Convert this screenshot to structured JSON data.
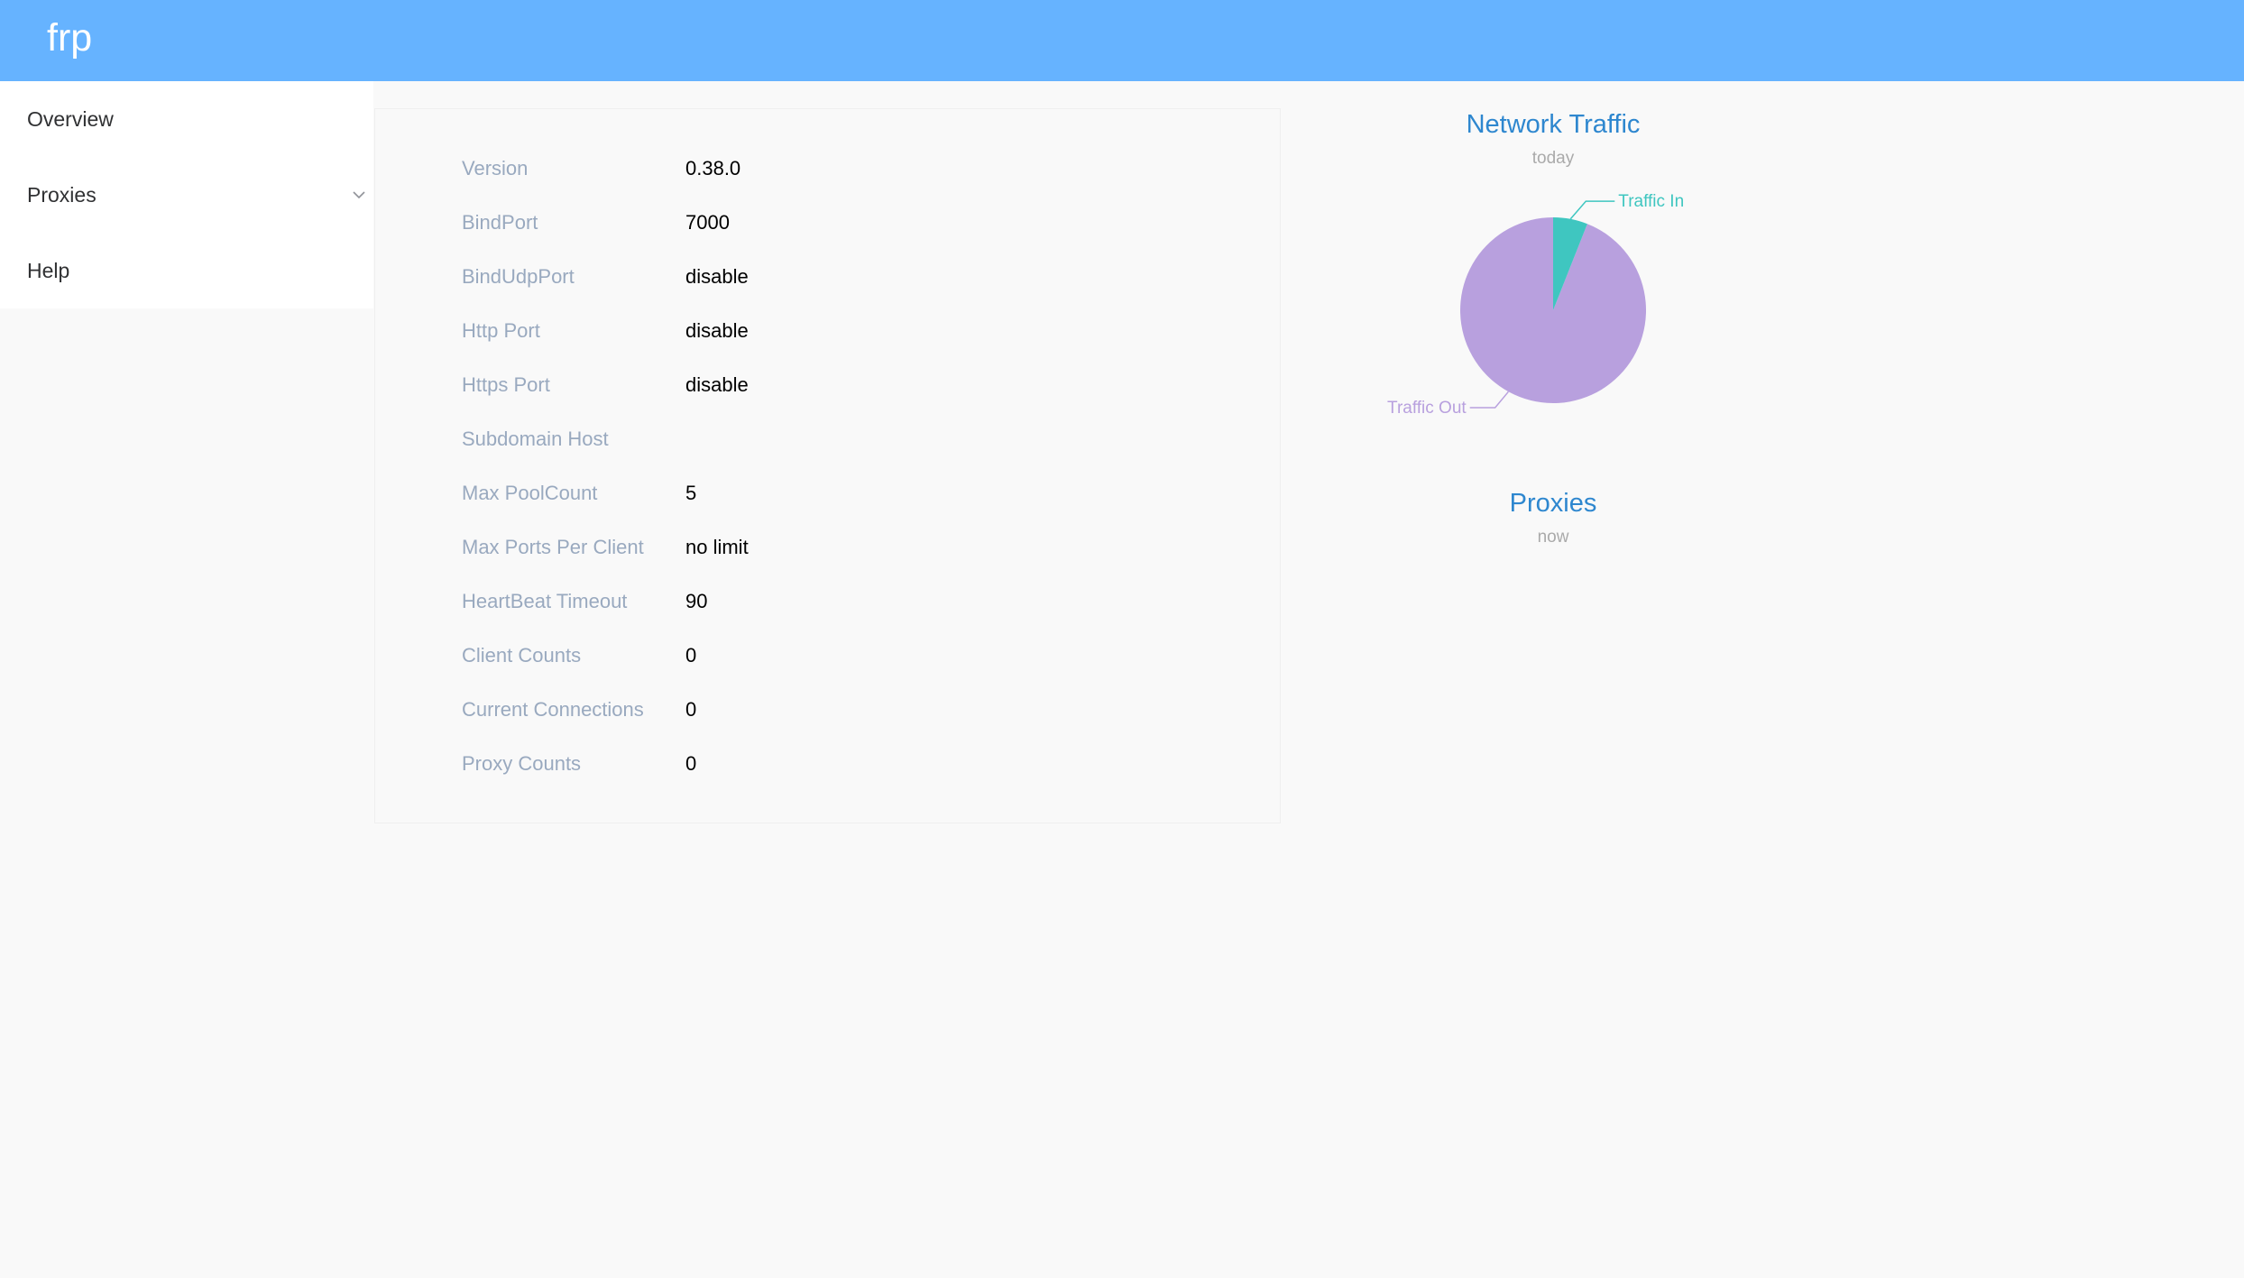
{
  "header": {
    "brand": "frp",
    "color": "#66b3ff"
  },
  "sidebar": {
    "items": [
      {
        "label": "Overview"
      },
      {
        "label": "Proxies",
        "icon": "chevron-down-icon"
      },
      {
        "label": "Help"
      }
    ]
  },
  "server_info": {
    "rows": [
      {
        "label": "Version",
        "value": "0.38.0"
      },
      {
        "label": "BindPort",
        "value": "7000"
      },
      {
        "label": "BindUdpPort",
        "value": "disable"
      },
      {
        "label": "Http Port",
        "value": "disable"
      },
      {
        "label": "Https Port",
        "value": "disable"
      },
      {
        "label": "Subdomain Host",
        "value": ""
      },
      {
        "label": "Max PoolCount",
        "value": "5"
      },
      {
        "label": "Max Ports Per Client",
        "value": "no limit"
      },
      {
        "label": "HeartBeat Timeout",
        "value": "90"
      },
      {
        "label": "Client Counts",
        "value": "0"
      },
      {
        "label": "Current Connections",
        "value": "0"
      },
      {
        "label": "Proxy Counts",
        "value": "0"
      }
    ]
  },
  "traffic_chart": {
    "title": "Network Traffic",
    "subtitle": "today"
  },
  "proxies_chart": {
    "title": "Proxies",
    "subtitle": "now"
  },
  "chart_data": {
    "type": "pie",
    "title": "Network Traffic",
    "subtitle": "today",
    "series": [
      {
        "name": "Traffic In",
        "value": 6,
        "color": "#3fc6c0"
      },
      {
        "name": "Traffic Out",
        "value": 94,
        "color": "#b8a0de"
      }
    ]
  }
}
